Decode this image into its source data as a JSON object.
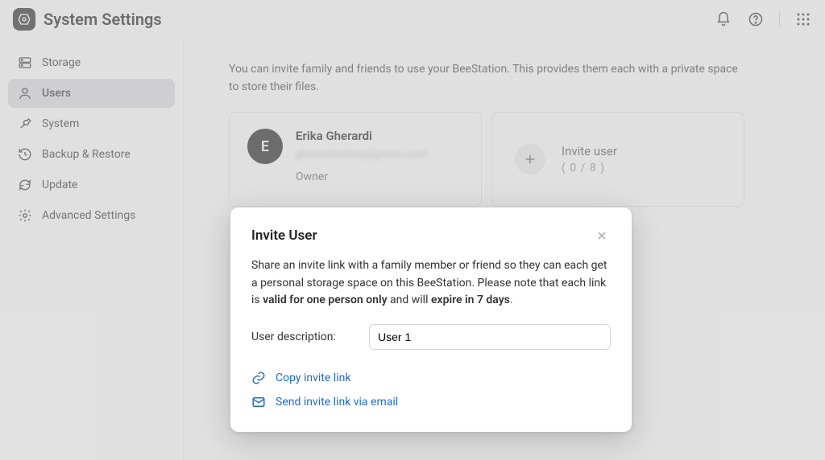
{
  "header": {
    "title": "System Settings"
  },
  "sidebar": {
    "items": [
      {
        "label": "Storage"
      },
      {
        "label": "Users"
      },
      {
        "label": "System"
      },
      {
        "label": "Backup & Restore"
      },
      {
        "label": "Update"
      },
      {
        "label": "Advanced Settings"
      }
    ],
    "activeIndex": 1
  },
  "main": {
    "intro": "You can invite family and friends to use your BeeStation. This provides them each with a private space to store their files.",
    "user": {
      "avatarInitial": "E",
      "name": "Erika Gherardi",
      "email": "gherardierika@gmail.com",
      "role": "Owner"
    },
    "invite": {
      "title": "Invite user",
      "count": "( 0 / 8 )"
    }
  },
  "modal": {
    "title": "Invite User",
    "body_pre": "Share an invite link with a family member or friend so they can each get a personal storage space on this BeeStation. Please note that each link is ",
    "body_bold1": "valid for one person only",
    "body_mid": " and will ",
    "body_bold2": "expire in 7 days",
    "body_end": ".",
    "fieldLabel": "User description:",
    "fieldValue": "User 1",
    "copyLink": "Copy invite link",
    "emailLink": "Send invite link via email"
  }
}
